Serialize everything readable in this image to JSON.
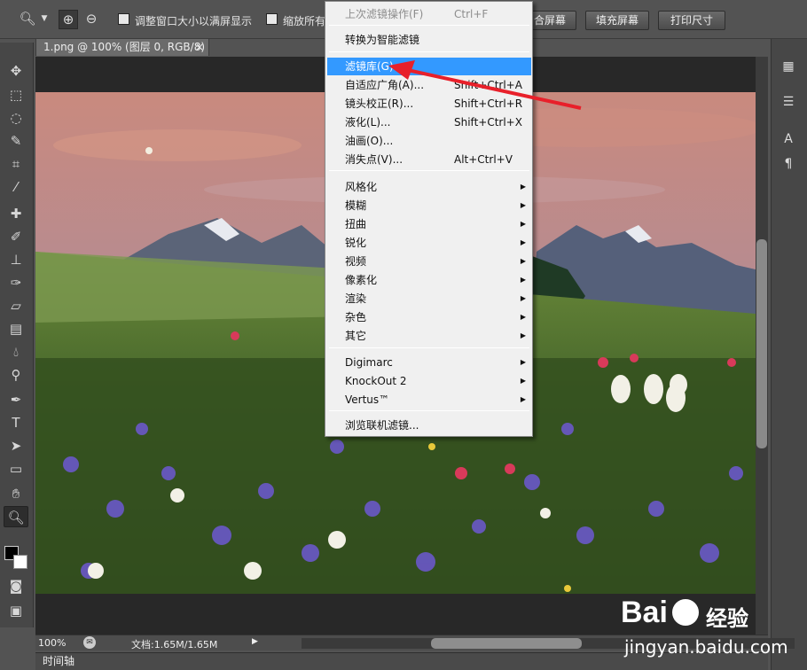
{
  "options_bar": {
    "resize_label": "调整窗口大小以满屏显示",
    "zoom_all_label": "缩放所有",
    "fit_screen_label": "合屏幕",
    "fill_screen_label": "填充屏幕",
    "print_size_label": "打印尺寸"
  },
  "document_tab": {
    "title": "1.png @ 100% (图层 0, RGB/8)",
    "close": "×"
  },
  "filter_menu": {
    "items": [
      {
        "label": "上次滤镜操作(F)",
        "shortcut": "Ctrl+F",
        "disabled": true
      },
      {
        "label": "转换为智能滤镜"
      },
      {
        "label": "滤镜库(G)...",
        "highlighted": true
      },
      {
        "label": "自适应广角(A)...",
        "shortcut": "Shift+Ctrl+A"
      },
      {
        "label": "镜头校正(R)...",
        "shortcut": "Shift+Ctrl+R"
      },
      {
        "label": "液化(L)...",
        "shortcut": "Shift+Ctrl+X"
      },
      {
        "label": "油画(O)..."
      },
      {
        "label": "消失点(V)...",
        "shortcut": "Alt+Ctrl+V"
      },
      {
        "label": "风格化",
        "submenu": true
      },
      {
        "label": "模糊",
        "submenu": true
      },
      {
        "label": "扭曲",
        "submenu": true
      },
      {
        "label": "锐化",
        "submenu": true
      },
      {
        "label": "视频",
        "submenu": true
      },
      {
        "label": "像素化",
        "submenu": true
      },
      {
        "label": "渲染",
        "submenu": true
      },
      {
        "label": "杂色",
        "submenu": true
      },
      {
        "label": "其它",
        "submenu": true
      },
      {
        "label": "Digimarc",
        "submenu": true
      },
      {
        "label": "KnockOut 2",
        "submenu": true
      },
      {
        "label": "Vertus™",
        "submenu": true
      },
      {
        "label": "浏览联机滤镜..."
      }
    ],
    "submenu_arrow": "▶"
  },
  "status_bar": {
    "zoom": "100%",
    "doc_info": "文档:1.65M/1.65M"
  },
  "timeline": {
    "label": "时间轴"
  },
  "watermark": {
    "brand": "Bai",
    "brand_suffix": "经验",
    "url": "jingyan.baidu.com"
  },
  "colors": {
    "ui_dark": "#535353",
    "menu_bg": "#f0f0f0",
    "menu_highlight": "#3399ff",
    "annotation_arrow": "#e8202a"
  }
}
